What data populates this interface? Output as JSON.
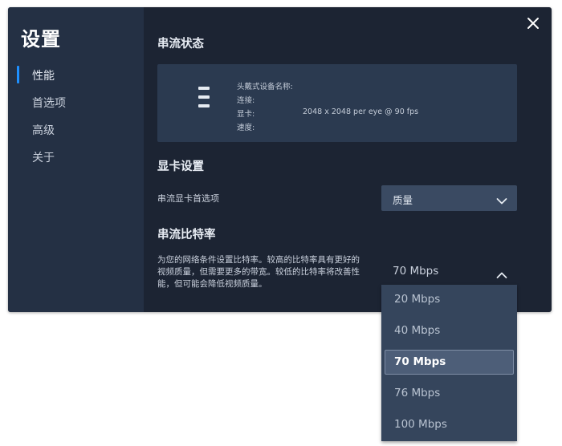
{
  "sidebar": {
    "title": "设置",
    "items": [
      {
        "label": "性能",
        "active": true
      },
      {
        "label": "首选项",
        "active": false
      },
      {
        "label": "高级",
        "active": false
      },
      {
        "label": "关于",
        "active": false
      }
    ]
  },
  "window": {
    "close_icon": "close-icon"
  },
  "streaming_status": {
    "title": "串流状态",
    "device_icon": "headset-icon",
    "rows": [
      {
        "label": "头戴式设备名称:",
        "value": ""
      },
      {
        "label": "连接:",
        "value": ""
      },
      {
        "label": "显卡:",
        "value": "2048 x 2048 per eye @ 90 fps"
      },
      {
        "label": "速度:",
        "value": ""
      }
    ]
  },
  "gpu_settings": {
    "title": "显卡设置",
    "preference_label": "串流显卡首选项",
    "preference_value": "质量"
  },
  "bitrate": {
    "title": "串流比特率",
    "description": "为您的网络条件设置比特率。较高的比特率具有更好的视频质量，但需要更多的带宽。较低的比特率将改善性能，但可能会降低视频质量。",
    "selected": "70 Mbps",
    "options": [
      "20 Mbps",
      "40 Mbps",
      "70 Mbps",
      "76 Mbps",
      "100 Mbps"
    ]
  },
  "colors": {
    "accent": "#1e90ff",
    "panel": "#1c2433",
    "sidebar": "#243044"
  }
}
